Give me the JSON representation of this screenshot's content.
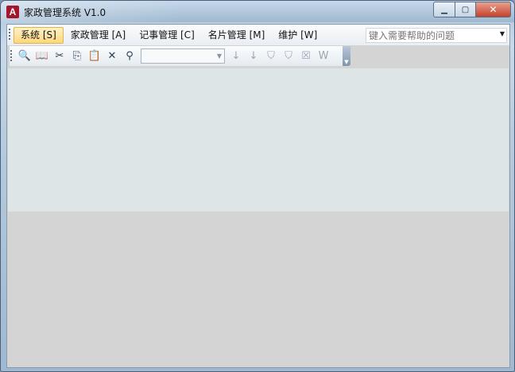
{
  "window": {
    "title": "家政管理系统 V1.0",
    "app_icon_letter": "A"
  },
  "menu": {
    "items": [
      {
        "label": "系统 [S]",
        "active": true
      },
      {
        "label": "家政管理 [A]"
      },
      {
        "label": "记事管理 [C]"
      },
      {
        "label": "名片管理 [M]"
      },
      {
        "label": "维护 [W]"
      }
    ],
    "help_placeholder": "键入需要帮助的问题"
  },
  "toolbar": {
    "buttons": [
      {
        "icon": "print-preview-icon",
        "glyph": "🔍"
      },
      {
        "icon": "open-book-icon",
        "glyph": "📖"
      },
      {
        "icon": "cut-icon",
        "glyph": "✂"
      },
      {
        "icon": "copy-icon",
        "glyph": "⎘"
      },
      {
        "icon": "paste-icon",
        "glyph": "📋"
      },
      {
        "icon": "delete-icon",
        "glyph": "✕"
      },
      {
        "icon": "find-icon",
        "glyph": "⚲"
      },
      {
        "icon": "sort-ascending-icon",
        "glyph": "↓"
      },
      {
        "icon": "sort-descending-icon",
        "glyph": "↓"
      },
      {
        "icon": "filter-by-selection-icon",
        "glyph": "⛉"
      },
      {
        "icon": "filter-by-form-icon",
        "glyph": "⛉"
      },
      {
        "icon": "apply-filter-icon",
        "glyph": "☒"
      },
      {
        "icon": "word-icon",
        "glyph": "W"
      }
    ],
    "combo_value": ""
  }
}
